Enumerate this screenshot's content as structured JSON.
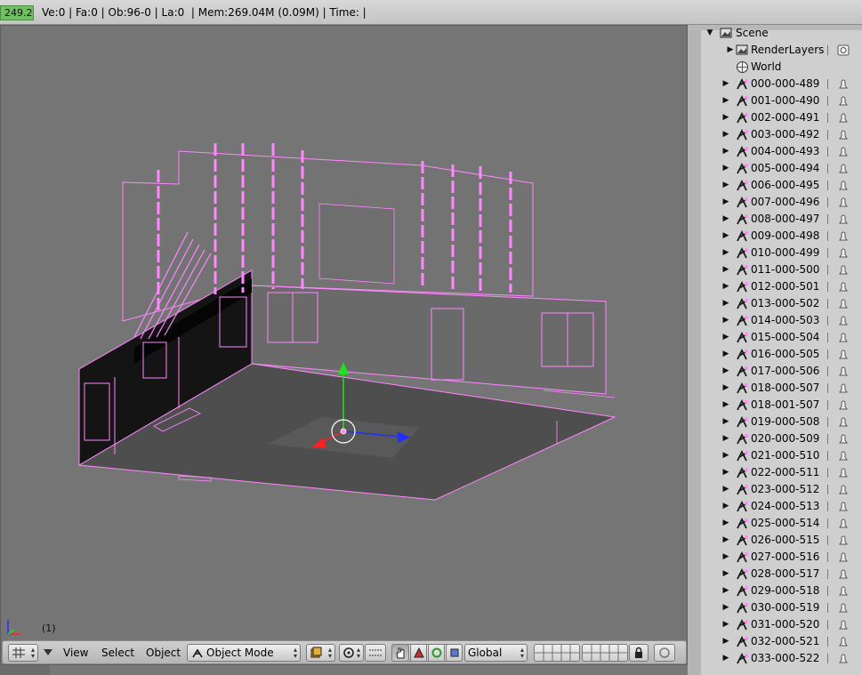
{
  "infobar": {
    "progress_text": "249.2",
    "stats": "Ve:0 | Fa:0 | Ob:96-0 | La:0  | Mem:269.04M (0.09M) | Time: |"
  },
  "viewport": {
    "frame_label": "(1)",
    "widget_colors": {
      "x_axis": "#ff2020",
      "y_axis": "#20e020",
      "z_axis": "#2030ff",
      "wire": "#ff88ff"
    }
  },
  "header": {
    "view_menu": "View",
    "select_menu": "Select",
    "object_menu": "Object",
    "mode_value": "Object Mode",
    "orientation_value": "Global"
  },
  "outliner": {
    "scene_label": "Scene",
    "renderlayers_label": "RenderLayers",
    "world_label": "World",
    "objects": [
      "000-000-489",
      "001-000-490",
      "002-000-491",
      "003-000-492",
      "004-000-493",
      "005-000-494",
      "006-000-495",
      "007-000-496",
      "008-000-497",
      "009-000-498",
      "010-000-499",
      "011-000-500",
      "012-000-501",
      "013-000-502",
      "014-000-503",
      "015-000-504",
      "016-000-505",
      "017-000-506",
      "018-000-507",
      "018-001-507",
      "019-000-508",
      "020-000-509",
      "021-000-510",
      "022-000-511",
      "023-000-512",
      "024-000-513",
      "025-000-514",
      "026-000-515",
      "027-000-516",
      "028-000-517",
      "029-000-518",
      "030-000-519",
      "031-000-520",
      "032-000-521",
      "033-000-522"
    ]
  }
}
